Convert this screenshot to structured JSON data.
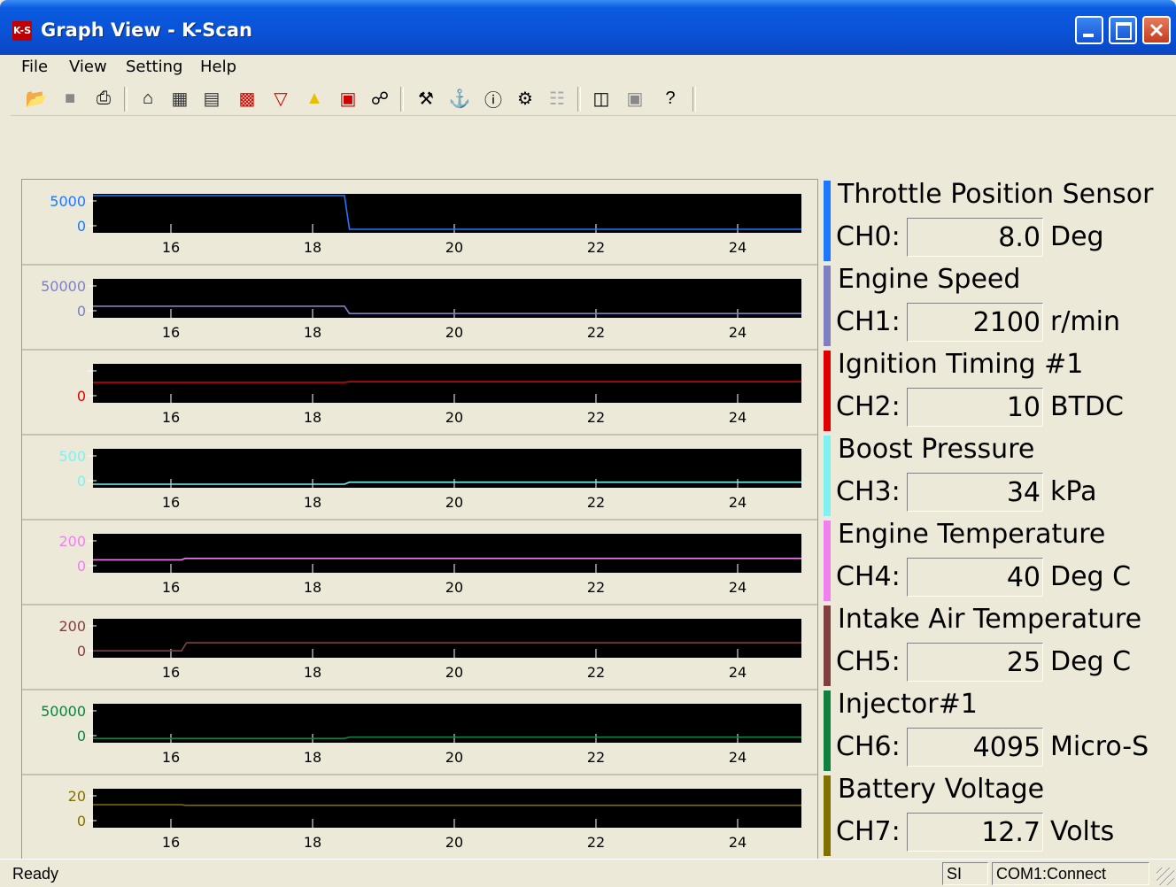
{
  "window": {
    "title": "Graph View - K-Scan",
    "app_icon": "K-S"
  },
  "menu": [
    "File",
    "View",
    "Setting",
    "Help"
  ],
  "toolbar": [
    "open-icon",
    "save-icon",
    "print-icon",
    "home-icon",
    "grid-view-icon",
    "list-view-icon",
    "bar-chart-icon",
    "filter-icon",
    "warning-icon",
    "report-icon",
    "preview-icon",
    "wrench-icon",
    "tool-disabled-icon",
    "info-icon",
    "config-icon",
    "disabled-icon",
    "capture-icon",
    "window-icon",
    "help-icon"
  ],
  "x_ticks": [
    "16",
    "18",
    "20",
    "22",
    "24"
  ],
  "channels": [
    {
      "name": "Throttle Position Sensor",
      "ch": "CH0:",
      "value": "8.0",
      "unit": "Deg",
      "color": "#1E78FF",
      "ytop": "5000",
      "ybot": "0"
    },
    {
      "name": "Engine Speed",
      "ch": "CH1:",
      "value": "2100",
      "unit": "r/min",
      "color": "#8080C0",
      "ytop": "50000",
      "ybot": "0"
    },
    {
      "name": "Ignition Timing #1",
      "ch": "CH2:",
      "value": "10",
      "unit": "BTDC",
      "color": "#E00000",
      "ytop": "",
      "ybot": "0"
    },
    {
      "name": "Boost Pressure",
      "ch": "CH3:",
      "value": "34",
      "unit": "kPa",
      "color": "#80F0F0",
      "ytop": "500",
      "ybot": "0"
    },
    {
      "name": "Engine Temperature",
      "ch": "CH4:",
      "value": "40",
      "unit": "Deg C",
      "color": "#F080F0",
      "ytop": "200",
      "ybot": "0"
    },
    {
      "name": "Intake Air Temperature",
      "ch": "CH5:",
      "value": "25",
      "unit": "Deg C",
      "color": "#804040",
      "ytop": "200",
      "ybot": "0"
    },
    {
      "name": "Injector#1",
      "ch": "CH6:",
      "value": "4095",
      "unit": "Micro-S",
      "color": "#108040",
      "ytop": "50000",
      "ybot": "0"
    },
    {
      "name": "Battery Voltage",
      "ch": "CH7:",
      "value": "12.7",
      "unit": "Volts",
      "color": "#807000",
      "ytop": "20",
      "ybot": "0"
    }
  ],
  "status": {
    "ready": "Ready",
    "units": "SI",
    "port": "COM1:Connect"
  }
}
